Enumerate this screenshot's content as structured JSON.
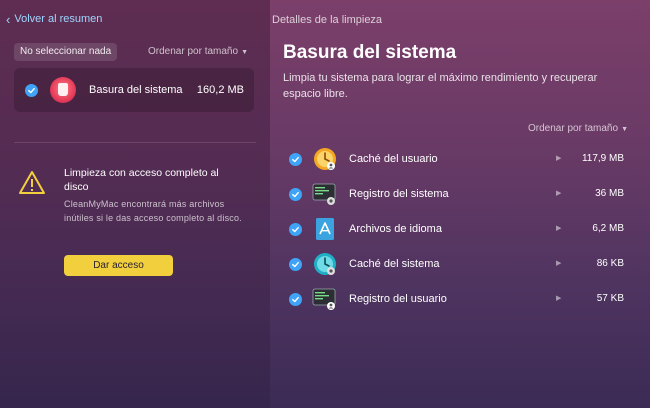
{
  "header": {
    "back_label": "Volver al resumen",
    "window_title": "Detalles de la limpieza"
  },
  "left": {
    "select_none": "No seleccionar nada",
    "sort": "Ordenar por tamaño",
    "selected_item": {
      "name": "Basura del sistema",
      "size": "160,2 MB"
    },
    "warning": {
      "title": "Limpieza con acceso completo al disco",
      "text": "CleanMyMac encontrará más archivos inútiles si le das acceso completo al disco.",
      "button": "Dar acceso"
    }
  },
  "main": {
    "title": "Basura del sistema",
    "description": "Limpia tu sistema para lograr el máximo rendimiento y recuperar espacio libre.",
    "sort": "Ordenar por tamaño",
    "items": [
      {
        "name": "Caché del usuario",
        "size": "117,9 MB",
        "icon": "user-cache-icon"
      },
      {
        "name": "Registro del sistema",
        "size": "36 MB",
        "icon": "system-log-icon"
      },
      {
        "name": "Archivos de idioma",
        "size": "6,2 MB",
        "icon": "language-files-icon"
      },
      {
        "name": "Caché del sistema",
        "size": "86 KB",
        "icon": "system-cache-icon"
      },
      {
        "name": "Registro del usuario",
        "size": "57 KB",
        "icon": "user-log-icon"
      }
    ]
  },
  "colors": {
    "accent": "#3fa3f7",
    "button": "#f2cf3c",
    "link": "#9fd4ff"
  }
}
